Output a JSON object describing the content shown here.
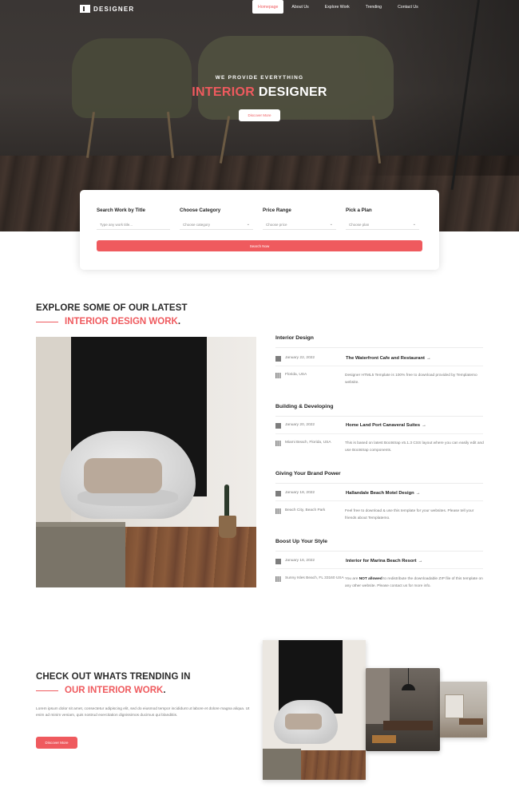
{
  "brand": {
    "logo_text": "DESIGNER"
  },
  "nav": {
    "items": [
      {
        "label": "Homepage",
        "active": true
      },
      {
        "label": "About Us",
        "active": false
      },
      {
        "label": "Explore Work",
        "active": false
      },
      {
        "label": "Trending",
        "active": false
      },
      {
        "label": "Contact Us",
        "active": false
      }
    ]
  },
  "hero": {
    "subtitle": "WE PROVIDE EVERYTHING",
    "title_accent": "INTERIOR",
    "title_rest": "DESIGNER",
    "button_label": "Discover More"
  },
  "search": {
    "fields": [
      {
        "label": "Search Work by Title",
        "placeholder": "Type any work title..."
      },
      {
        "label": "Choose Category",
        "value": "Choose category"
      },
      {
        "label": "Price Range",
        "value": "Choose price"
      },
      {
        "label": "Pick a Plan",
        "value": "Choose plan"
      }
    ],
    "button_label": "Search Now"
  },
  "explore": {
    "heading_line1": "EXPLORE SOME OF OUR LATEST",
    "heading_line2": "INTERIOR DESIGN WORK",
    "heading_dot": ".",
    "items": [
      {
        "category": "Interior Design",
        "date": "January 22, 2022",
        "location": "Florida, USA",
        "title": "The Waterfront Cafe and Restaurant",
        "desc_before": "Designer HTML5 Template is 100% free to download provided by Templatemo website.",
        "desc_bold": "",
        "desc_after": ""
      },
      {
        "category": "Building & Developing",
        "date": "January 20, 2022",
        "location": "Miami Beach, Florida, USA",
        "title": "Home Land Port Canaveral Suites",
        "desc_before": "This is based on latest Bootstrap v5.1.3 CSS layout where you can easily edit and use Bootstrap components.",
        "desc_bold": "",
        "desc_after": ""
      },
      {
        "category": "Giving Your Brand Power",
        "date": "January 18, 2022",
        "location": "Beach City, Beach Park",
        "title": "Hallandale Beach Motel Design",
        "desc_before": "Feel free to download & use this template for your websites. Please tell your friends about Templatemo.",
        "desc_bold": "",
        "desc_after": ""
      },
      {
        "category": "Boost Up Your Style",
        "date": "January 16, 2022",
        "location": "Sunny Isles Beach, FL 33160 USA",
        "title": "Interior for Marina Beach Resort",
        "desc_before": "You are ",
        "desc_bold": "NOT allowed",
        "desc_after": " to redistribute the downloadable ZIP file of this template on any other website. Please contact us for more info."
      }
    ]
  },
  "trending": {
    "heading_line1": "CHECK OUT WHATS TRENDING IN",
    "heading_line2": "OUR INTERIOR WORK",
    "heading_dot": ".",
    "paragraph": "Lorem ipsum dolor sit amet, consectetur adipiscing elit, sed do eiusmod tempor incididunt ut labore et dolore magna aliqua. Ut enim ad minim veniam, quis nostrud exercitation dignissimos ducimus qui blanditiis.",
    "button_label": "Discover More"
  },
  "colors": {
    "accent": "#ef5a5e",
    "hero_bg": "#3a3634",
    "text_dark": "#2a2a2a",
    "text_muted": "#777777"
  }
}
